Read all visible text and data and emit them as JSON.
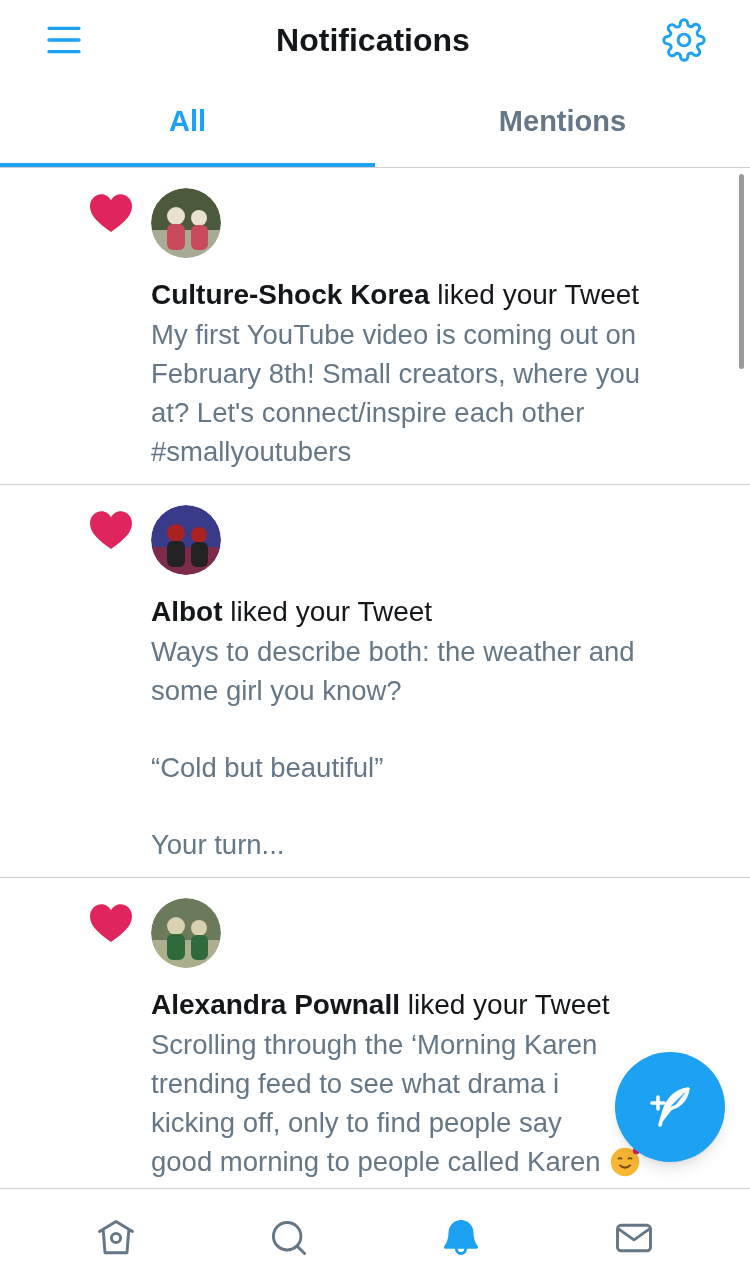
{
  "header": {
    "title": "Notifications"
  },
  "tabs": [
    {
      "label": "All",
      "selected": true
    },
    {
      "label": "Mentions",
      "selected": false
    }
  ],
  "notifications": [
    {
      "kind": "like",
      "user": "Culture-Shock Korea",
      "action": "liked your Tweet",
      "body": [
        [
          "My first YouTube video is coming out on",
          "February 8th! Small  creators, where you",
          "at? Let's connect/inspire each other",
          "#smallyoutubers"
        ]
      ]
    },
    {
      "kind": "like",
      "user": "Albot",
      "action": "liked your Tweet",
      "body": [
        [
          "Ways to describe both: the weather and",
          "some girl you know?"
        ],
        [
          "“Cold but beautiful”"
        ],
        [
          "Your turn..."
        ]
      ]
    },
    {
      "kind": "like",
      "user": "Alexandra Pownall",
      "action": "liked your Tweet",
      "body": [
        [
          "Scrolling through the ‘Morning Karen",
          "trending feed to see what drama i",
          "kicking off, only to find people say",
          "good morning to people called Karen"
        ]
      ],
      "emoji": true
    }
  ],
  "nav": [
    {
      "kind": "home",
      "selected": false
    },
    {
      "kind": "search",
      "selected": false
    },
    {
      "kind": "notifications",
      "selected": true
    },
    {
      "kind": "messages",
      "selected": false
    }
  ]
}
